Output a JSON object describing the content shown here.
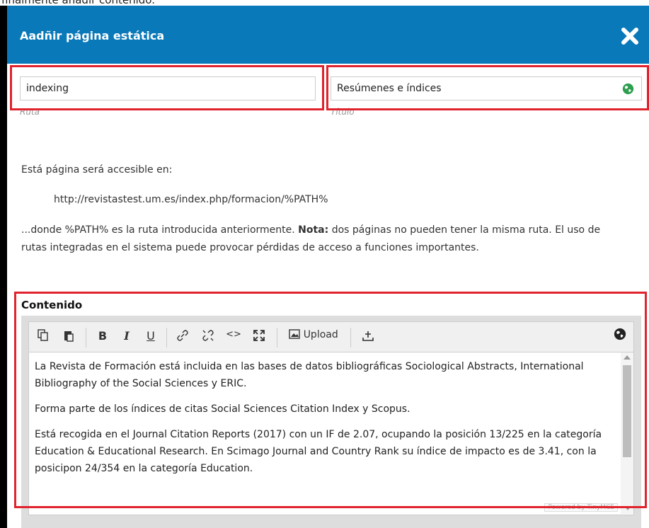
{
  "top_caption": "finalmente añadir contenido.",
  "modal": {
    "title": "Aadñir página estática",
    "close_icon": "close-icon"
  },
  "path_field": {
    "value": "indexing",
    "label": "Ruta"
  },
  "title_field": {
    "value": "Resúmenes e índices",
    "label": "Título",
    "icon": "globe-icon"
  },
  "info": {
    "accessible_text": "Está página será accesible en:",
    "url": "http://revistastest.um.es/index.php/formacion/%PATH%",
    "note_prefix": "...donde %PATH% es la ruta introducida anteriormente.",
    "note_bold": "Nota:",
    "note_suffix": "dos páginas no pueden tener la misma ruta. El uso de",
    "note_line2": "rutas integradas en el sistema puede provocar pérdidas de acceso a funciones importantes."
  },
  "editor": {
    "section_title": "Contenido",
    "toolbar": {
      "copy_icon": "copy-icon",
      "paste_icon": "paste-icon",
      "bold": "B",
      "italic": "I",
      "underline": "U",
      "link_icon": "link-icon",
      "unlink_icon": "unlink-icon",
      "code": "<>",
      "fullscreen_icon": "fullscreen-icon",
      "upload": "Upload",
      "insert_icon": "insert-icon",
      "globe_icon": "globe-icon"
    },
    "paragraphs": [
      "La Revista de Formación está incluida en las bases de datos bibliográficas Sociological Abstracts, International Bibliography of the Social Sciences y ERIC.",
      "Forma parte de los índices de citas Social Sciences Citation Index y Scopus.",
      "Está recogida en el Journal Citation Reports (2017) con un IF de 2.07, ocupando la posición 13/225 en la categoría Education & Educational Research. En Scimago Journal and Country Rank su índice de impacto es de 3.41, con la posicipon 24/354 en la categoría Education."
    ],
    "powered_by": "Powered by TinyMCE"
  },
  "colors": {
    "header_blue": "#0a79b9",
    "highlight_red": "#e0232d",
    "globe_green": "#2e9e4f"
  }
}
